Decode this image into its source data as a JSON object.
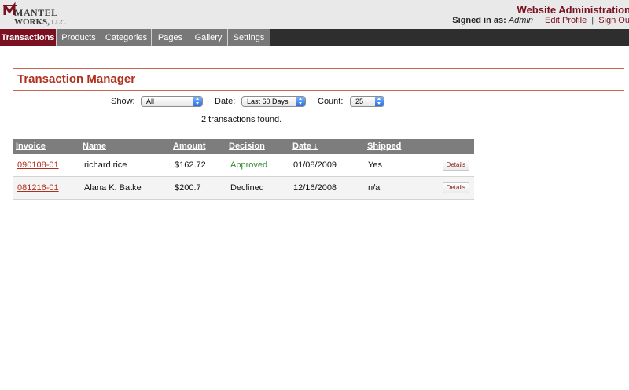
{
  "header": {
    "logo_line1": "MANTEL",
    "logo_line2": "WORKS",
    "logo_suffix": "LLC.",
    "site_title": "Website Administration",
    "signed_in_label": "Signed in as:",
    "user": "Admin",
    "edit_profile": "Edit Profile",
    "sign_out": "Sign Out",
    "separator": "|"
  },
  "nav": {
    "tabs": [
      {
        "label": "Transactions"
      },
      {
        "label": "Products"
      },
      {
        "label": "Categories"
      },
      {
        "label": "Pages"
      },
      {
        "label": "Gallery"
      },
      {
        "label": "Settings"
      }
    ]
  },
  "main": {
    "title": "Transaction Manager",
    "filters": {
      "show_label": "Show:",
      "show_value": "All",
      "date_label": "Date:",
      "date_value": "Last 60 Days",
      "count_label": "Count:",
      "count_value": "25"
    },
    "result_text": "2 transactions found."
  },
  "table": {
    "columns": [
      "Invoice",
      "Name",
      "Amount",
      "Decision",
      "Date ↓",
      "Shipped"
    ],
    "rows": [
      {
        "invoice": "090108-01",
        "name": "richard rice",
        "amount": "$162.72",
        "decision": "Approved",
        "date": "01/08/2009",
        "shipped": "Yes",
        "action": "Details"
      },
      {
        "invoice": "081216-01",
        "name": "Alana K. Batke",
        "amount": "$200.7",
        "decision": "Declined",
        "date": "12/16/2008",
        "shipped": "n/a",
        "action": "Details"
      }
    ]
  },
  "colors": {
    "brand": "#7a1020",
    "accent": "#b0301e",
    "approved": "#2f8a2f",
    "nav_bg": "#2e2e2e",
    "tab_bg": "#787878"
  }
}
